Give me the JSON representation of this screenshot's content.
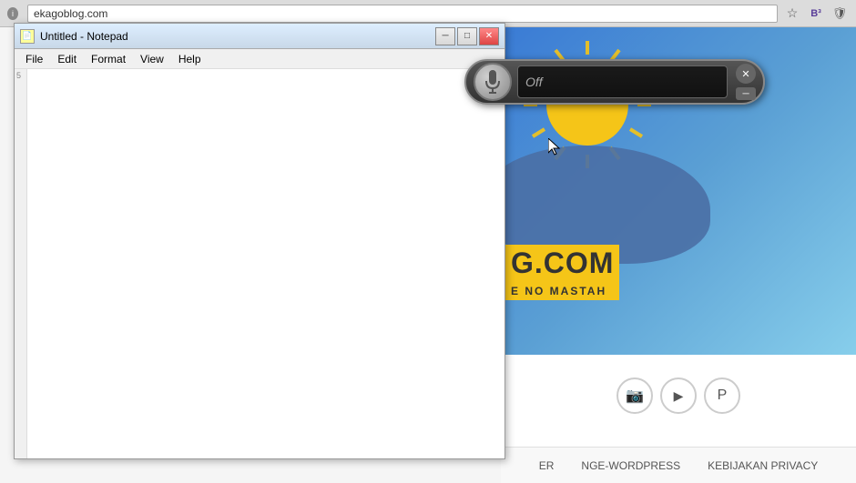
{
  "browser": {
    "url": "ekagoblog.com",
    "favicon": "i",
    "icons": {
      "star": "☆",
      "settings": "⚙",
      "ext1": "B3",
      "shield": "🛡"
    }
  },
  "notepad": {
    "title": "Untitled - Notepad",
    "icon": "📄",
    "menu": {
      "file": "File",
      "edit": "Edit",
      "format": "Format",
      "view": "View",
      "help": "Help"
    },
    "controls": {
      "minimize": "─",
      "maximize": "□",
      "close": "✕"
    },
    "content": ""
  },
  "voice_widget": {
    "status": "Off"
  },
  "website": {
    "logo_text": "G.COM",
    "tagline": "E NO MASTAH",
    "footer_links": [
      "ER",
      "NGE-WORDPRESS",
      "KEBIJAKAN PRIVACY"
    ]
  }
}
